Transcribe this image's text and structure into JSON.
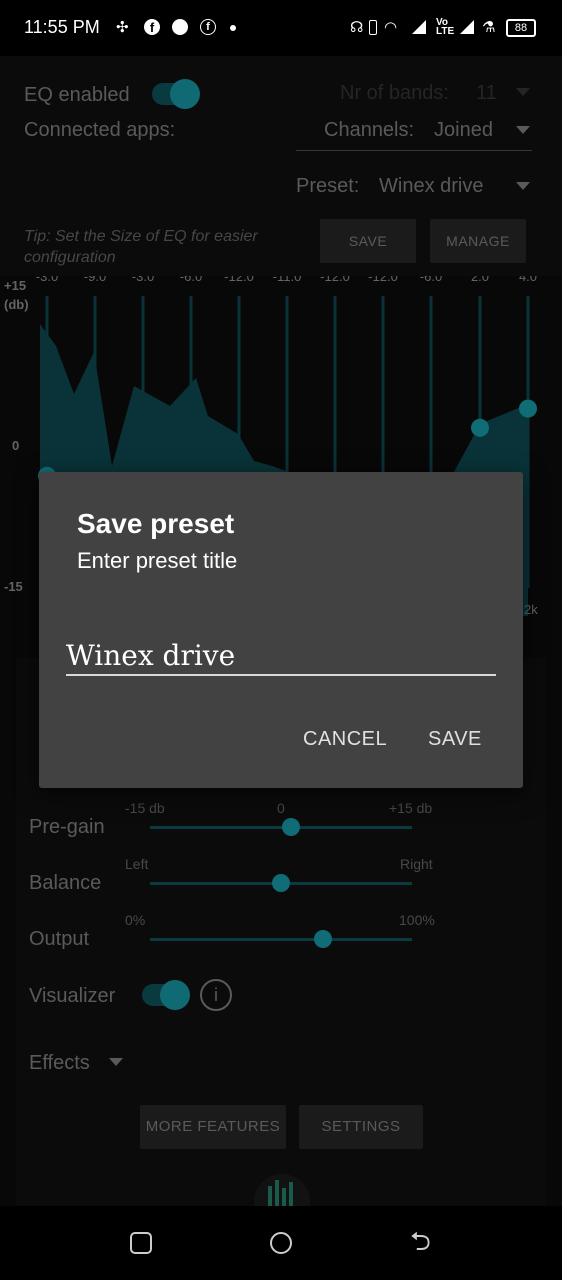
{
  "status_bar": {
    "time": "11:55 PM",
    "battery": "88",
    "icons": [
      "network-grid-icon",
      "facebook-icon",
      "messenger-icon",
      "facebook-icon",
      "dot-icon",
      "headphones-icon",
      "battery-saver-icon",
      "wifi-icon",
      "signal-icon",
      "volte-icon",
      "signal-icon",
      "flask-icon",
      "battery-icon"
    ]
  },
  "settings": {
    "eq_enabled_label": "EQ enabled",
    "nr_bands_label": "Nr of bands:",
    "nr_bands_value": "11",
    "connected_apps_label": "Connected apps:",
    "channels_label": "Channels:",
    "channels_value": "Joined",
    "preset_label": "Preset:",
    "preset_value": "Winex drive",
    "tip": "Tip: Set the Size of EQ for easier configuration",
    "save_button": "SAVE",
    "manage_button": "MANAGE"
  },
  "eq": {
    "top_labels": [
      "-3.0",
      "-9.0",
      "-3.0",
      "-6.0",
      "-12.0",
      "-11.0",
      "-12.0",
      "-12.0",
      "-6.0",
      "2.0",
      "4.0"
    ],
    "y_max_label": "+15\n(db)",
    "y_zero_label": "0",
    "y_min_label": "-15",
    "right_freq_label": "2k"
  },
  "controls": {
    "pregain_label": "Pre-gain",
    "pregain_min": "-15 db",
    "pregain_mid": "0",
    "pregain_max": "+15 db",
    "pregain_value": 0.54,
    "balance_label": "Balance",
    "balance_left": "Left",
    "balance_right": "Right",
    "balance_value": 0.5,
    "output_label": "Output",
    "output_min": "0%",
    "output_max": "100%",
    "output_value": 0.66,
    "visualizer_label": "Visualizer",
    "effects_label": "Effects",
    "more_features_button": "MORE FEATURES",
    "settings_button": "SETTINGS"
  },
  "dialog": {
    "title": "Save preset",
    "subtitle": "Enter preset title",
    "input_value": "Winex drive",
    "cancel_button": "CANCEL",
    "save_button": "SAVE"
  },
  "colors": {
    "accent": "#19a3b1",
    "dialog_bg": "#424242"
  }
}
